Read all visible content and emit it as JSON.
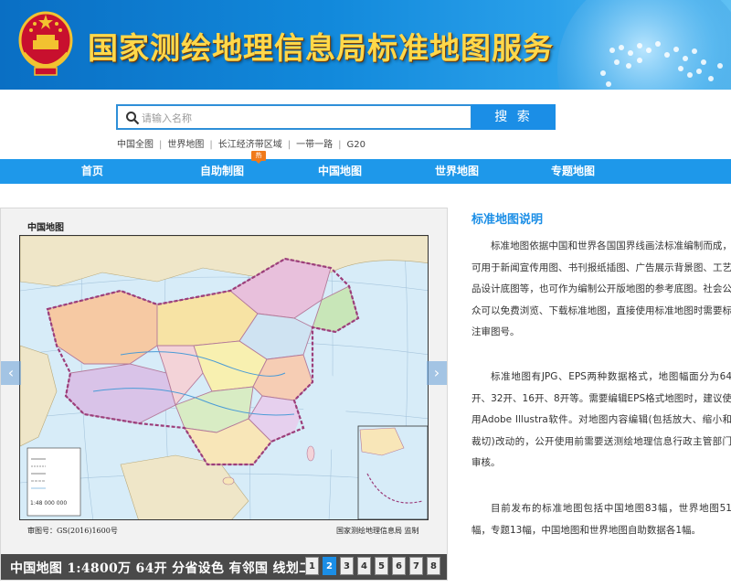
{
  "banner": {
    "title": "国家测绘地理信息局标准地图服务"
  },
  "search": {
    "placeholder": "请输入名称",
    "button_label": "搜 索"
  },
  "quicklinks": [
    "中国全图",
    "世界地图",
    "长江经济带区域",
    "一带一路",
    "G20"
  ],
  "nav": {
    "items": [
      "首页",
      "自助制图",
      "中国地图",
      "世界地图",
      "专题地图"
    ],
    "hot_badge": "热"
  },
  "map_card": {
    "title": "中国地图",
    "approval_no": "审图号：GS(2016)1600号",
    "publisher": "国家测绘地理信息局 监制",
    "legend_scale": "1:48 000 000",
    "prev_arrow": "‹",
    "next_arrow": "›"
  },
  "slideshow": {
    "caption": "中国地图 1:4800万 64开 分省设色 有邻国 线划二",
    "pages": [
      "1",
      "2",
      "3",
      "4",
      "5",
      "6",
      "7",
      "8"
    ],
    "active_page": "2"
  },
  "info": {
    "title": "标准地图说明",
    "paragraph_1": "标准地图依据中国和世界各国国界线画法标准编制而成，可用于新闻宣传用图、书刊报纸插图、广告展示背景图、工艺品设计底图等，也可作为编制公开版地图的参考底图。社会公众可以免费浏览、下载标准地图，直接使用标准地图时需要标注审图号。",
    "paragraph_2": "标准地图有JPG、EPS两种数据格式，地图幅面分为64开、32开、16开、8开等。需要编辑EPS格式地图时，建议使用Adobe Illustra软件。对地图内容编辑(包括放大、缩小和裁切)改动的，公开使用前需要送测绘地理信息行政主管部门审核。",
    "paragraph_3": "目前发布的标准地图包括中国地图83幅，世界地图51幅，专题13幅，中国地图和世界地图自助数据各1幅。"
  },
  "colors": {
    "banner_blue": "#0a6fc4",
    "title_gold": "#ffd84a",
    "nav_blue": "#1e98ea",
    "accent_blue": "#1b8ee6",
    "hot_orange": "#f07a1a"
  }
}
